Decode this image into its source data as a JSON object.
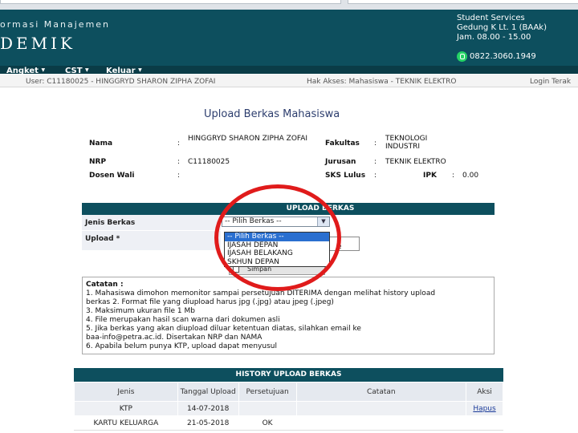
{
  "header": {
    "sys_name": "ormasi Manajemen",
    "app_name": "DEMIK",
    "service_lines": [
      "Student Services",
      "Gedung K Lt. 1 (BAAk)",
      "Jam. 08.00 - 15.00"
    ],
    "phone": "0822.3060.1949"
  },
  "nav": {
    "items": [
      {
        "label": "Angket"
      },
      {
        "label": "CST"
      },
      {
        "label": "Keluar"
      }
    ]
  },
  "infobar": {
    "user": "User: C11180025 - HINGGRYD SHARON ZIPHA ZOFAI",
    "access": "Hak Akses: Mahasiswa - TEKNIK ELEKTRO",
    "login": "Login Terak"
  },
  "page": {
    "title": "Upload Berkas Mahasiswa"
  },
  "student": {
    "nama_label": "Nama",
    "nama_value": "HINGGRYD SHARON ZIPHA ZOFAI",
    "nrp_label": "NRP",
    "nrp_value": "C11180025",
    "wali_label": "Dosen Wali",
    "wali_value": "",
    "fakultas_label": "Fakultas",
    "fakultas_value": "TEKNOLOGI INDUSTRI",
    "jurusan_label": "Jurusan",
    "jurusan_value": "TEKNIK ELEKTRO",
    "sks_label": "SKS Lulus",
    "sks_value": "",
    "ipk_label": "IPK",
    "ipk_value": "0.00",
    "colon": ":"
  },
  "form": {
    "header": "UPLOAD BERKAS",
    "jenis_label": "Jenis Berkas",
    "upload_label": "Upload *",
    "selected": "-- Pilih Berkas --",
    "options": [
      "-- Pilih Berkas --",
      "IJASAH DEPAN",
      "IJASAH BELAKANG",
      "SKHUN DEPAN"
    ],
    "file_tail": "e",
    "submit_label": "Simpan"
  },
  "notes": {
    "title": "Catatan :",
    "lines": [
      "1. Mahasiswa dimohon memonitor sampai persetujuan DITERIMA dengan melihat history upload",
      "berkas 2. Format file yang diupload harus jpg (.jpg) atau jpeg (.jpeg)",
      "3. Maksimum ukuran file 1 Mb",
      "4. File merupakan hasil scan warna dari dokumen asli",
      "5. Jika berkas yang akan diupload diluar ketentuan diatas, silahkan email ke",
      "baa-info@petra.ac.id. Disertakan NRP dan NAMA",
      "6. Apabila belum punya KTP, upload dapat menyusul"
    ]
  },
  "history": {
    "title": "HISTORY UPLOAD BERKAS",
    "columns": [
      "Jenis",
      "Tanggal Upload",
      "Persetujuan",
      "Catatan",
      "Aksi"
    ],
    "rows": [
      {
        "jenis": "KTP",
        "tanggal": "14-07-2018",
        "persetujuan": "",
        "catatan": "",
        "aksi": "Hapus"
      },
      {
        "jenis": "KARTU KELUARGA",
        "tanggal": "21-05-2018",
        "persetujuan": "OK",
        "catatan": "",
        "aksi": ""
      }
    ]
  },
  "colors": {
    "header_bg": "#0d4f5e",
    "highlight": "#e01b1b",
    "selected_option": "#2a6fd0"
  }
}
